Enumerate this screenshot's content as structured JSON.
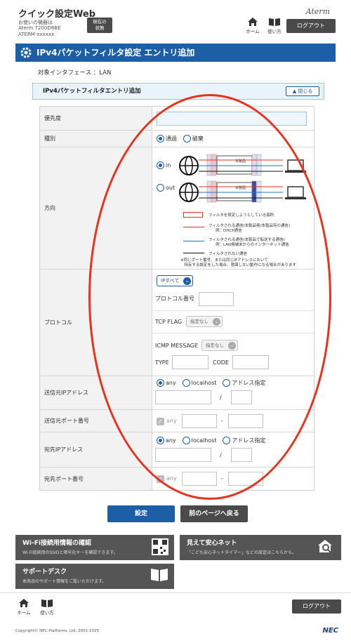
{
  "header": {
    "app_title": "クイック設定Web",
    "model_lines": [
      "お使いの機器は",
      "Aterm 7200D8BE",
      "ATERM-xxxxxx"
    ],
    "status_button": [
      "現在の",
      "状態"
    ],
    "logo": "Aterm",
    "home_label": "ホーム",
    "help_label": "使い方",
    "logout_label": "ログアウト"
  },
  "page": {
    "title": "IPv4パケットフィルタ設定 エントリ追加",
    "interface_label": "対象インタフェース ：LAN",
    "section_title": "IPv4パケットフィルタエントリ追加",
    "collapse_label": "閉じる"
  },
  "form": {
    "priority": {
      "label": "優先度",
      "value": ""
    },
    "type": {
      "label": "種別",
      "options": [
        "通過",
        "破棄"
      ],
      "selected": "通過"
    },
    "direction": {
      "label": "方向",
      "options": [
        "in",
        "out"
      ],
      "selected": "in",
      "device_label": "本製品",
      "legend": [
        "フィルタを設定しようとしている個所",
        "フィルタされる通信(本製品発/本製品宛の通信)",
        "例：DHCP通信",
        "フィルタされる通信(本製品で転送する通信)",
        "例：LAN側端末からのインターネット通信",
        "フィルタされない通信"
      ],
      "note": [
        "※同じポート番号、または同じIPアドレスにおいて",
        "　特反する設定をした場合、意図しない動作になる場合があります"
      ]
    },
    "protocol": {
      "label": "プロトコル",
      "protocol_select": "IPすべて",
      "protocol_number_label": "プロトコル番号",
      "tcp_flag_label": "TCP FLAG",
      "tcp_flag_select": "指定なし",
      "icmp_label": "ICMP MESSAGE",
      "icmp_select": "指定なし",
      "type_label": "TYPE",
      "code_label": "CODE"
    },
    "src_ip": {
      "label": "送信元IPアドレス",
      "options": [
        "any",
        "localhost",
        "アドレス指定"
      ],
      "selected": "any",
      "slash": "/"
    },
    "src_port": {
      "label": "送信元ポート番号",
      "any_label": "any",
      "dash": "-"
    },
    "dst_ip": {
      "label": "宛先IPアドレス",
      "options": [
        "any",
        "localhost",
        "アドレス指定"
      ],
      "selected": "any",
      "slash": "/"
    },
    "dst_port": {
      "label": "宛先ポート番号",
      "any_label": "any",
      "dash": "-"
    }
  },
  "actions": {
    "submit": "設定",
    "back": "前のページへ戻る"
  },
  "tiles": [
    {
      "title": "Wi-Fi接続用情報の確認",
      "desc": "Wi-Fi接続用のSSIDと暗号化キーを確認できます。",
      "icon": "qr-code-icon"
    },
    {
      "title": "見えて安心ネット",
      "desc": "「こども安心ネットタイマー」などの設定はこちらから。",
      "icon": "home-search-icon"
    },
    {
      "title": "サポートデスク",
      "desc": "本商品のサポート情報をご覧いただけます。",
      "icon": "book-icon"
    }
  ],
  "footer": {
    "home_label": "ホーム",
    "help_label": "使い方",
    "logout_label": "ログアウト",
    "copyright": "Copyright© NEC Platforms, Ltd. 2001-2025",
    "brand": "NEC"
  },
  "colors": {
    "primary": "#1d5fa6",
    "dark_button": "#4a4a4a",
    "annotation": "#e8321d"
  }
}
